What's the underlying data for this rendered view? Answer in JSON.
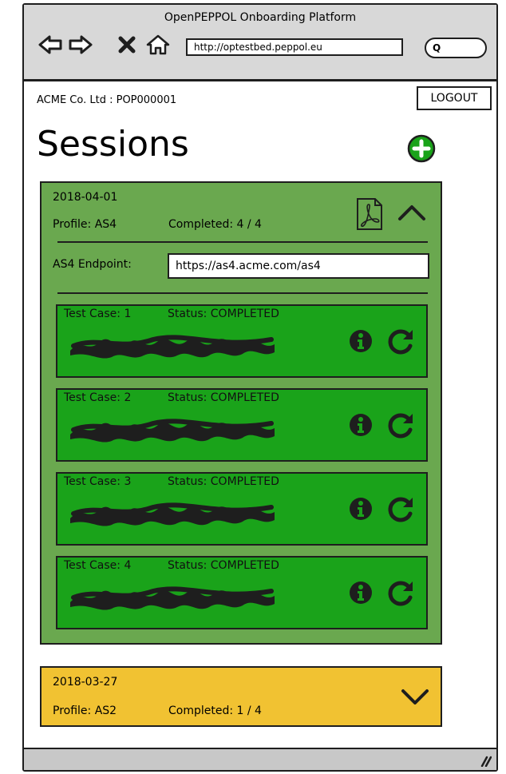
{
  "window": {
    "title": "OpenPEPPOL Onboarding Platform",
    "url": "http://optestbed.peppol.eu",
    "search_glyph": "Q"
  },
  "header": {
    "account": "ACME Co. Ltd : POP000001",
    "logout_label": "LOGOUT"
  },
  "page": {
    "title": "Sessions"
  },
  "sessions": [
    {
      "date": "2018-04-01",
      "profile": "Profile: AS4",
      "completed": "Completed: 4 / 4",
      "expanded": true,
      "color": "#6aa84f",
      "endpoint_label": "AS4 Endpoint:",
      "endpoint_value": "https://as4.acme.com/as4",
      "test_cases": [
        {
          "name": "Test Case: 1",
          "status": "Status: COMPLETED"
        },
        {
          "name": "Test Case: 2",
          "status": "Status: COMPLETED"
        },
        {
          "name": "Test Case: 3",
          "status": "Status: COMPLETED"
        },
        {
          "name": "Test Case: 4",
          "status": "Status: COMPLETED"
        }
      ]
    },
    {
      "date": "2018-03-27",
      "profile": "Profile: AS2",
      "completed": "Completed: 1 / 4",
      "expanded": false,
      "color": "#f1c232"
    }
  ],
  "icons": {
    "back": "arrow-left-icon",
    "forward": "arrow-right-icon",
    "stop": "close-icon",
    "home": "home-icon",
    "add": "plus-circle-icon",
    "pdf": "pdf-icon",
    "collapse": "chevron-up-icon",
    "expand": "chevron-down-icon",
    "info": "info-icon",
    "rerun": "refresh-icon"
  },
  "colors": {
    "session_completed": "#6aa84f",
    "session_in_progress": "#f1c232",
    "test_case": "#1aa31a",
    "add": "#1aa31a"
  }
}
